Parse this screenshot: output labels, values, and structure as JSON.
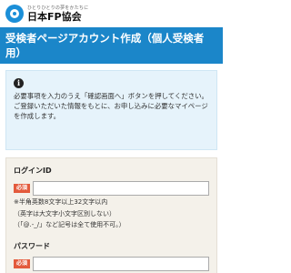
{
  "logo": {
    "tagline": "ひとりひとりの夢をかたちに",
    "name": "日本FP協会",
    "icon": "fp-logo-icon"
  },
  "title": "受検者ページアカウント作成（個人受検者用）",
  "info": {
    "icon": "info-icon",
    "lines": [
      "必要事項を入力のうえ「確認画面へ」ボタンを押してください。",
      "ご登録いただいた情報をもとに、お申し込みに必要なマイページを作成します。"
    ]
  },
  "form": {
    "login_id": {
      "label": "ログインID",
      "required_badge": "必須",
      "value": "",
      "help": [
        "※半角英数8文字以上32文字以内",
        "（英字は大文字小文字区別しない）",
        "（「@.-_/」など記号は全て使用不可。）"
      ]
    },
    "password": {
      "label": "パスワード",
      "required_badge": "必須",
      "value": ""
    }
  },
  "colors": {
    "title_bar": "#1b86c9",
    "info_bg": "#e6f3fb",
    "form_bg": "#f4f1ea",
    "required": "#e35a3c"
  }
}
